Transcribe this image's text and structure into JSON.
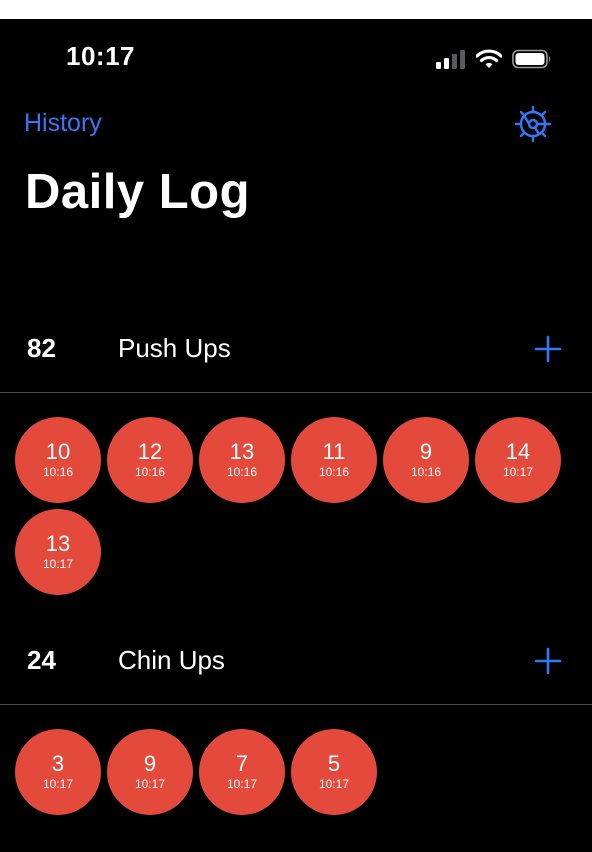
{
  "status_bar": {
    "time": "10:17",
    "icons": [
      "cellular-signal-icon",
      "wifi-icon",
      "battery-icon"
    ]
  },
  "nav": {
    "history_label": "History",
    "settings_icon": "gear-icon"
  },
  "title": "Daily Log",
  "colors": {
    "background": "#000000",
    "accent": "#3478f6",
    "bubble": "#e44a3c",
    "divider": "#4a4a4c"
  },
  "sections": [
    {
      "total": "82",
      "name": "Push Ups",
      "entries": [
        {
          "count": "10",
          "time": "10:16"
        },
        {
          "count": "12",
          "time": "10:16"
        },
        {
          "count": "13",
          "time": "10:16"
        },
        {
          "count": "11",
          "time": "10:16"
        },
        {
          "count": "9",
          "time": "10:16"
        },
        {
          "count": "14",
          "time": "10:17"
        },
        {
          "count": "13",
          "time": "10:17"
        }
      ]
    },
    {
      "total": "24",
      "name": "Chin Ups",
      "entries": [
        {
          "count": "3",
          "time": "10:17"
        },
        {
          "count": "9",
          "time": "10:17"
        },
        {
          "count": "7",
          "time": "10:17"
        },
        {
          "count": "5",
          "time": "10:17"
        }
      ]
    }
  ]
}
